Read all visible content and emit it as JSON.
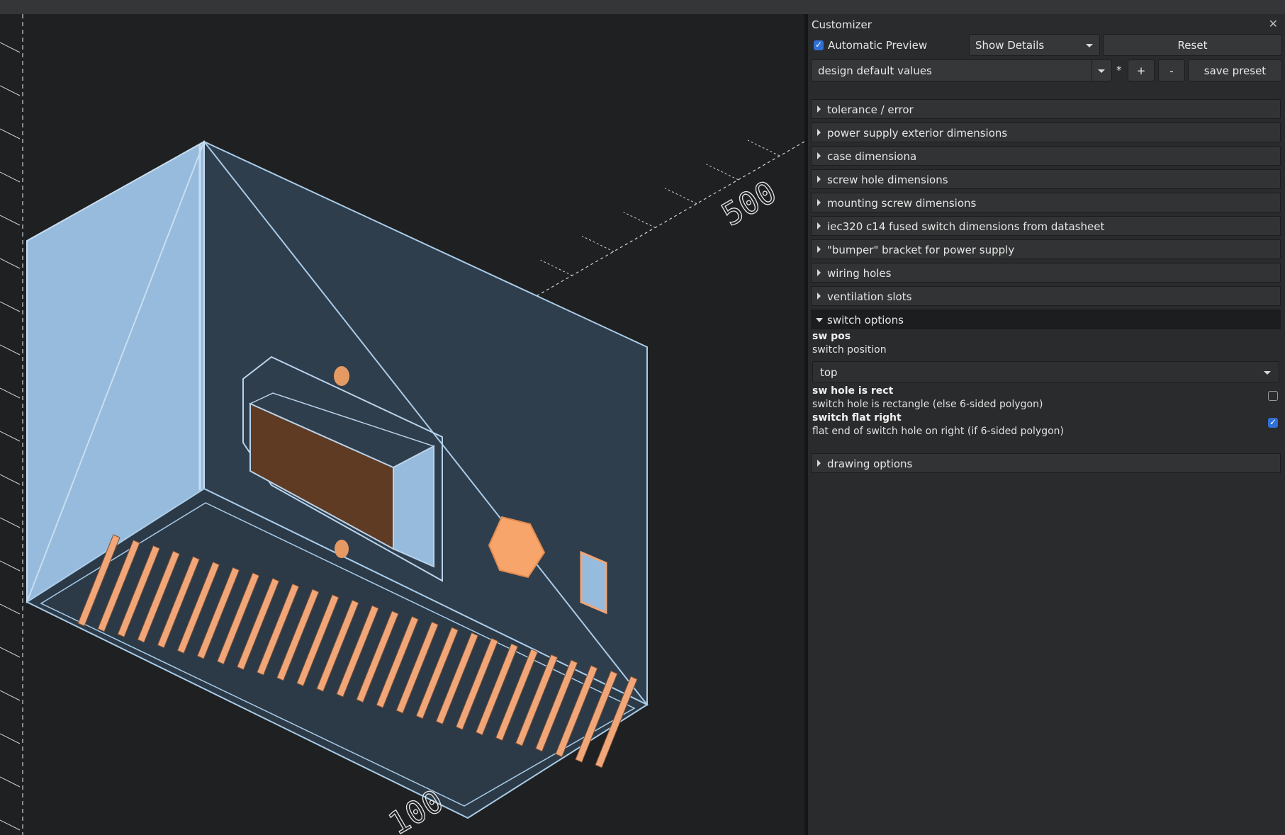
{
  "viewport": {
    "ruler_label_top": "500",
    "ruler_label_bottom": "100",
    "colors": {
      "case": "#a9cbe8",
      "case_dark": "#2f3e4d",
      "slot": "#f0a679",
      "switch": "#5f3b24",
      "hex": "#f7a56b"
    }
  },
  "customizer": {
    "title": "Customizer",
    "close_icon": "close-icon",
    "auto_preview_label": "Automatic Preview",
    "auto_preview_checked": true,
    "details_select": "Show Details",
    "reset_label": "Reset",
    "preset_select": "design default values",
    "preset_modified": "*",
    "add_label": "+",
    "remove_label": "-",
    "save_label": "save preset",
    "groups": [
      {
        "label": "tolerance / error"
      },
      {
        "label": "power supply exterior dimensions"
      },
      {
        "label": "case dimensiona"
      },
      {
        "label": "screw hole dimensions"
      },
      {
        "label": "mounting screw dimensions"
      },
      {
        "label": "iec320 c14 fused switch dimensions from datasheet"
      },
      {
        "label": "\"bumper\" bracket for power supply"
      },
      {
        "label": "wiring holes"
      },
      {
        "label": "ventilation slots"
      },
      {
        "label": "switch options"
      },
      {
        "label": "drawing options"
      }
    ],
    "switch_options": {
      "sw_pos_name": "sw pos",
      "sw_pos_desc": "switch position",
      "sw_pos_value": "top",
      "sw_hole_name": "sw hole is rect",
      "sw_hole_desc": "switch hole is rectangle (else 6-sided polygon)",
      "sw_hole_checked": false,
      "flat_right_name": "switch flat right",
      "flat_right_desc": "flat end of switch hole on right (if 6-sided polygon)",
      "flat_right_checked": true
    }
  }
}
